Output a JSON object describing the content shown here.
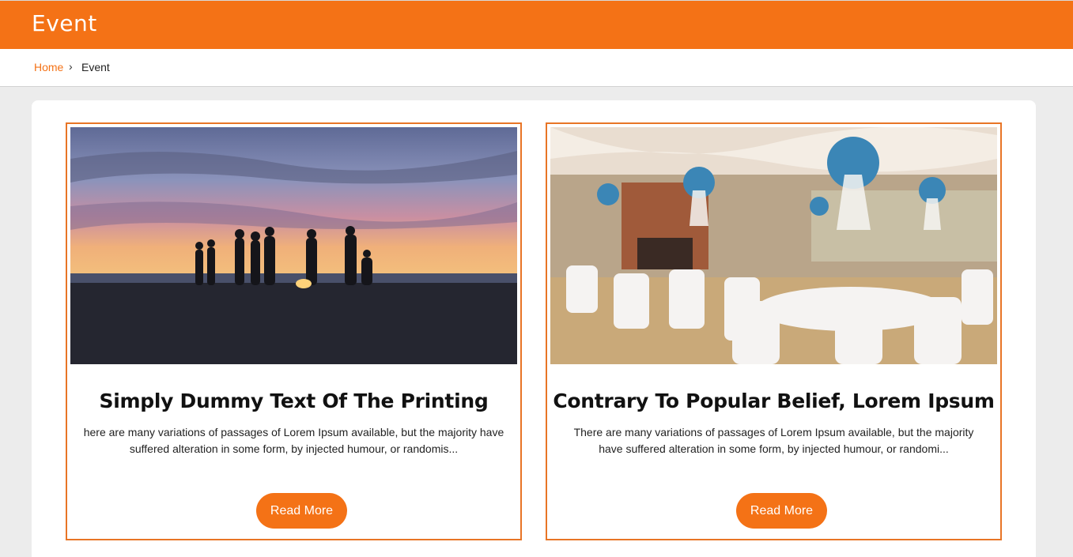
{
  "header": {
    "title": "Event"
  },
  "breadcrumb": {
    "home": "Home",
    "separator": "›",
    "current": "Event"
  },
  "events": [
    {
      "title": "Simply Dummy Text Of The Printing",
      "text": "here are many variations of passages of Lorem Ipsum available, but the majority have suffered alteration in some form, by injected humour, or randomis...",
      "button": "Read More",
      "image": "beach-bonfire-sunset-photo"
    },
    {
      "title": "Contrary To Popular Belief, Lorem Ipsum",
      "text": "There are many variations of passages of Lorem Ipsum available, but the majority have suffered alteration in some form, by injected humour, or randomi...",
      "button": "Read More",
      "image": "banquet-hall-balloons-photo"
    }
  ],
  "colors": {
    "accent": "#f47216",
    "page_bg": "#ececec"
  }
}
